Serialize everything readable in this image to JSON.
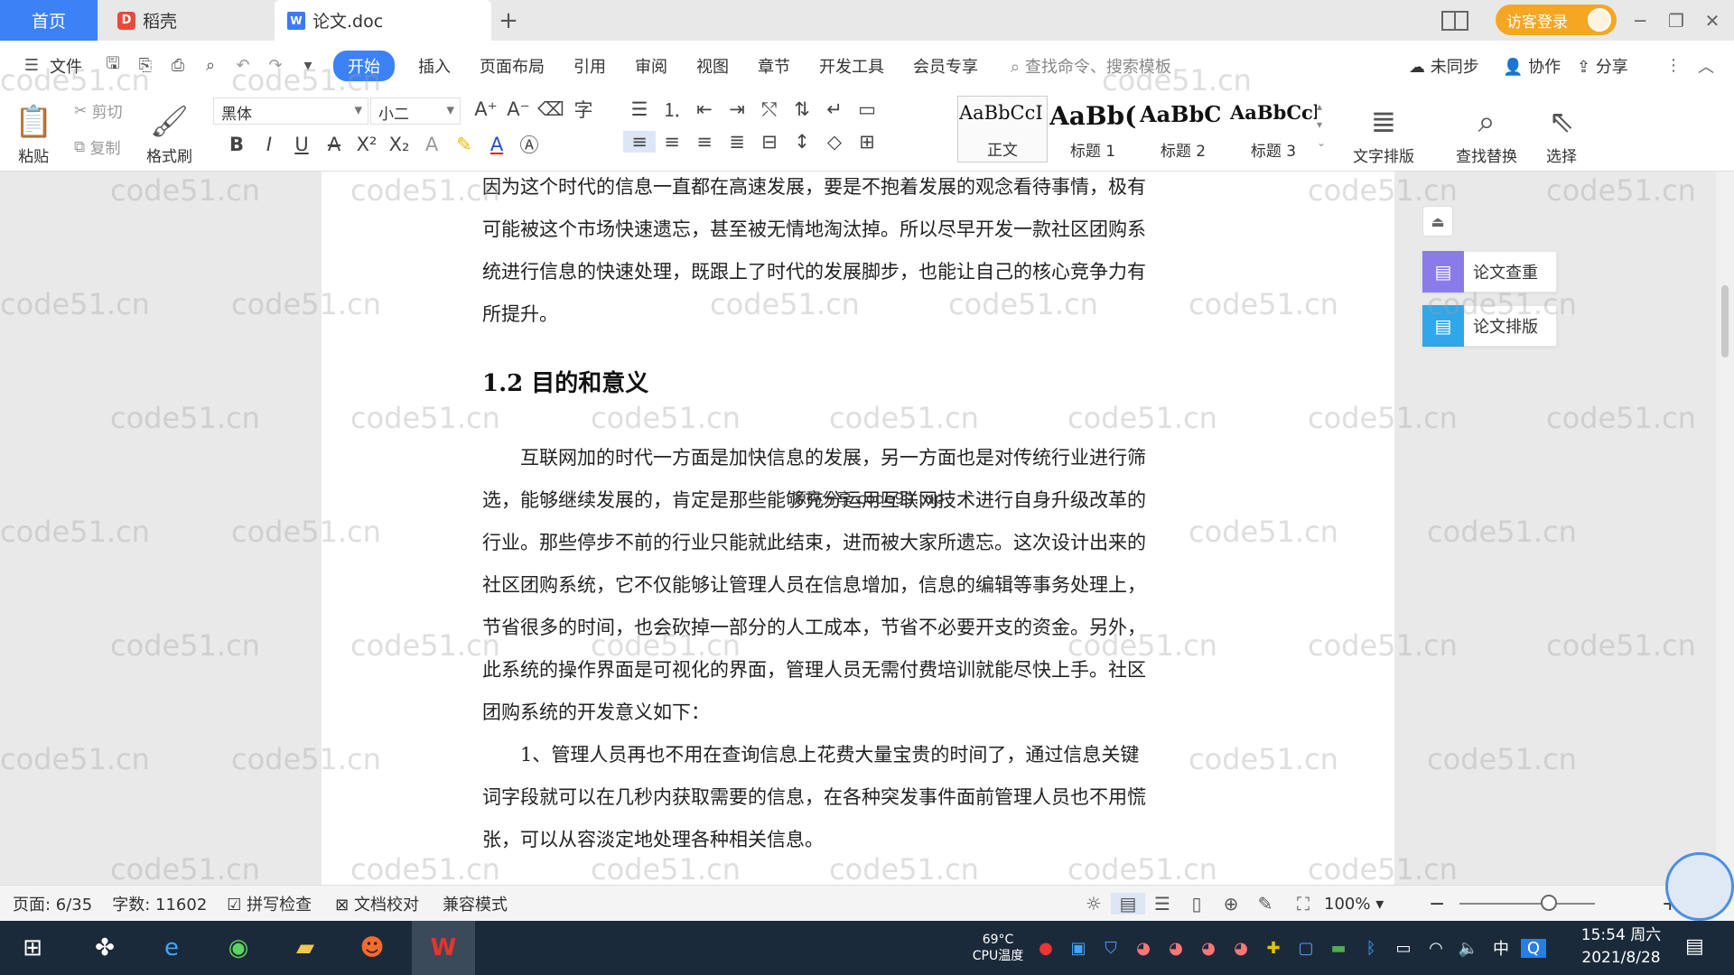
{
  "tabs": {
    "home": "首页",
    "daoke": "稻壳",
    "doc": "论文.doc",
    "new_tab": "+"
  },
  "titlebar": {
    "visitor_login": "访客登录"
  },
  "menu": {
    "file": "文件",
    "items": [
      "开始",
      "插入",
      "页面布局",
      "引用",
      "审阅",
      "视图",
      "章节",
      "开发工具",
      "会员专享"
    ],
    "search_placeholder": "查找命令、搜索模板",
    "sync": "未同步",
    "collab": "协作",
    "share": "分享"
  },
  "ribbon": {
    "paste": "粘贴",
    "cut": "剪切",
    "copy": "复制",
    "format_painter": "格式刷",
    "font": "黑体",
    "size": "小二",
    "styles": [
      {
        "sample": "AaBbCcI",
        "label": "正文"
      },
      {
        "sample": "AaBb(",
        "label": "标题 1"
      },
      {
        "sample": "AaBbC",
        "label": "标题 2"
      },
      {
        "sample": "AaBbCcl",
        "label": "标题 3"
      }
    ],
    "text_layout": "文字排版",
    "find_replace": "查找替换",
    "select": "选择"
  },
  "side": {
    "check": "论文查重",
    "layout": "论文排版"
  },
  "document": {
    "para1": [
      "因为这个时代的信息一直都在高速发展，要是不抱着发展的观念看待事情，极有",
      "可能被这个市场快速遗忘，甚至被无情地淘汰掉。所以尽早开发一款社区团购系",
      "统进行信息的快速处理，既跟上了时代的发展脚步，也能让自己的核心竞争力有",
      "所提升。"
    ],
    "heading": "1.2 目的和意义",
    "para2": [
      "　　互联网加的时代一方面是加快信息的发展，另一方面也是对传统行业进行筛",
      "选，能够继续发展的，肯定是那些能够充分运用互联网技术进行自身升级改革的",
      "行业。那些停步不前的行业只能就此结束，进而被大家所遗忘。这次设计出来的",
      "社区团购系统，它不仅能够让管理人员在信息增加，信息的编辑等事务处理上，",
      "节省很多的时间，也会砍掉一部分的人工成本，节省不必要开支的资金。另外，",
      "此系统的操作界面是可视化的界面，管理人员无需付费培训就能尽快上手。社区",
      "团购系统的开发意义如下："
    ],
    "para3": [
      "　　1、管理人员再也不用在查询信息上花费大量宝贵的时间了，通过信息关键",
      "词字段就可以在几秒内获取需要的信息，在各种突发事件面前管理人员也不用慌",
      "张，可以从容淡定地处理各种相关信息。"
    ],
    "overlay_watermark": "源码分享 code99.top"
  },
  "statusbar": {
    "page": "页面: 6/35",
    "words": "字数: 11602",
    "spell": "拼写检查",
    "proof": "文档校对",
    "compat": "兼容模式",
    "zoom": "100%"
  },
  "taskbar": {
    "cpu_temp": "69°C",
    "cpu_label": "CPU温度",
    "ime": "中",
    "time": "15:54 周六",
    "date": "2021/8/28"
  },
  "watermark": "code51.cn",
  "colors": {
    "accent": "#3c82f6",
    "visitor": "#f5a623",
    "taskbar": "#1b2a3a"
  }
}
